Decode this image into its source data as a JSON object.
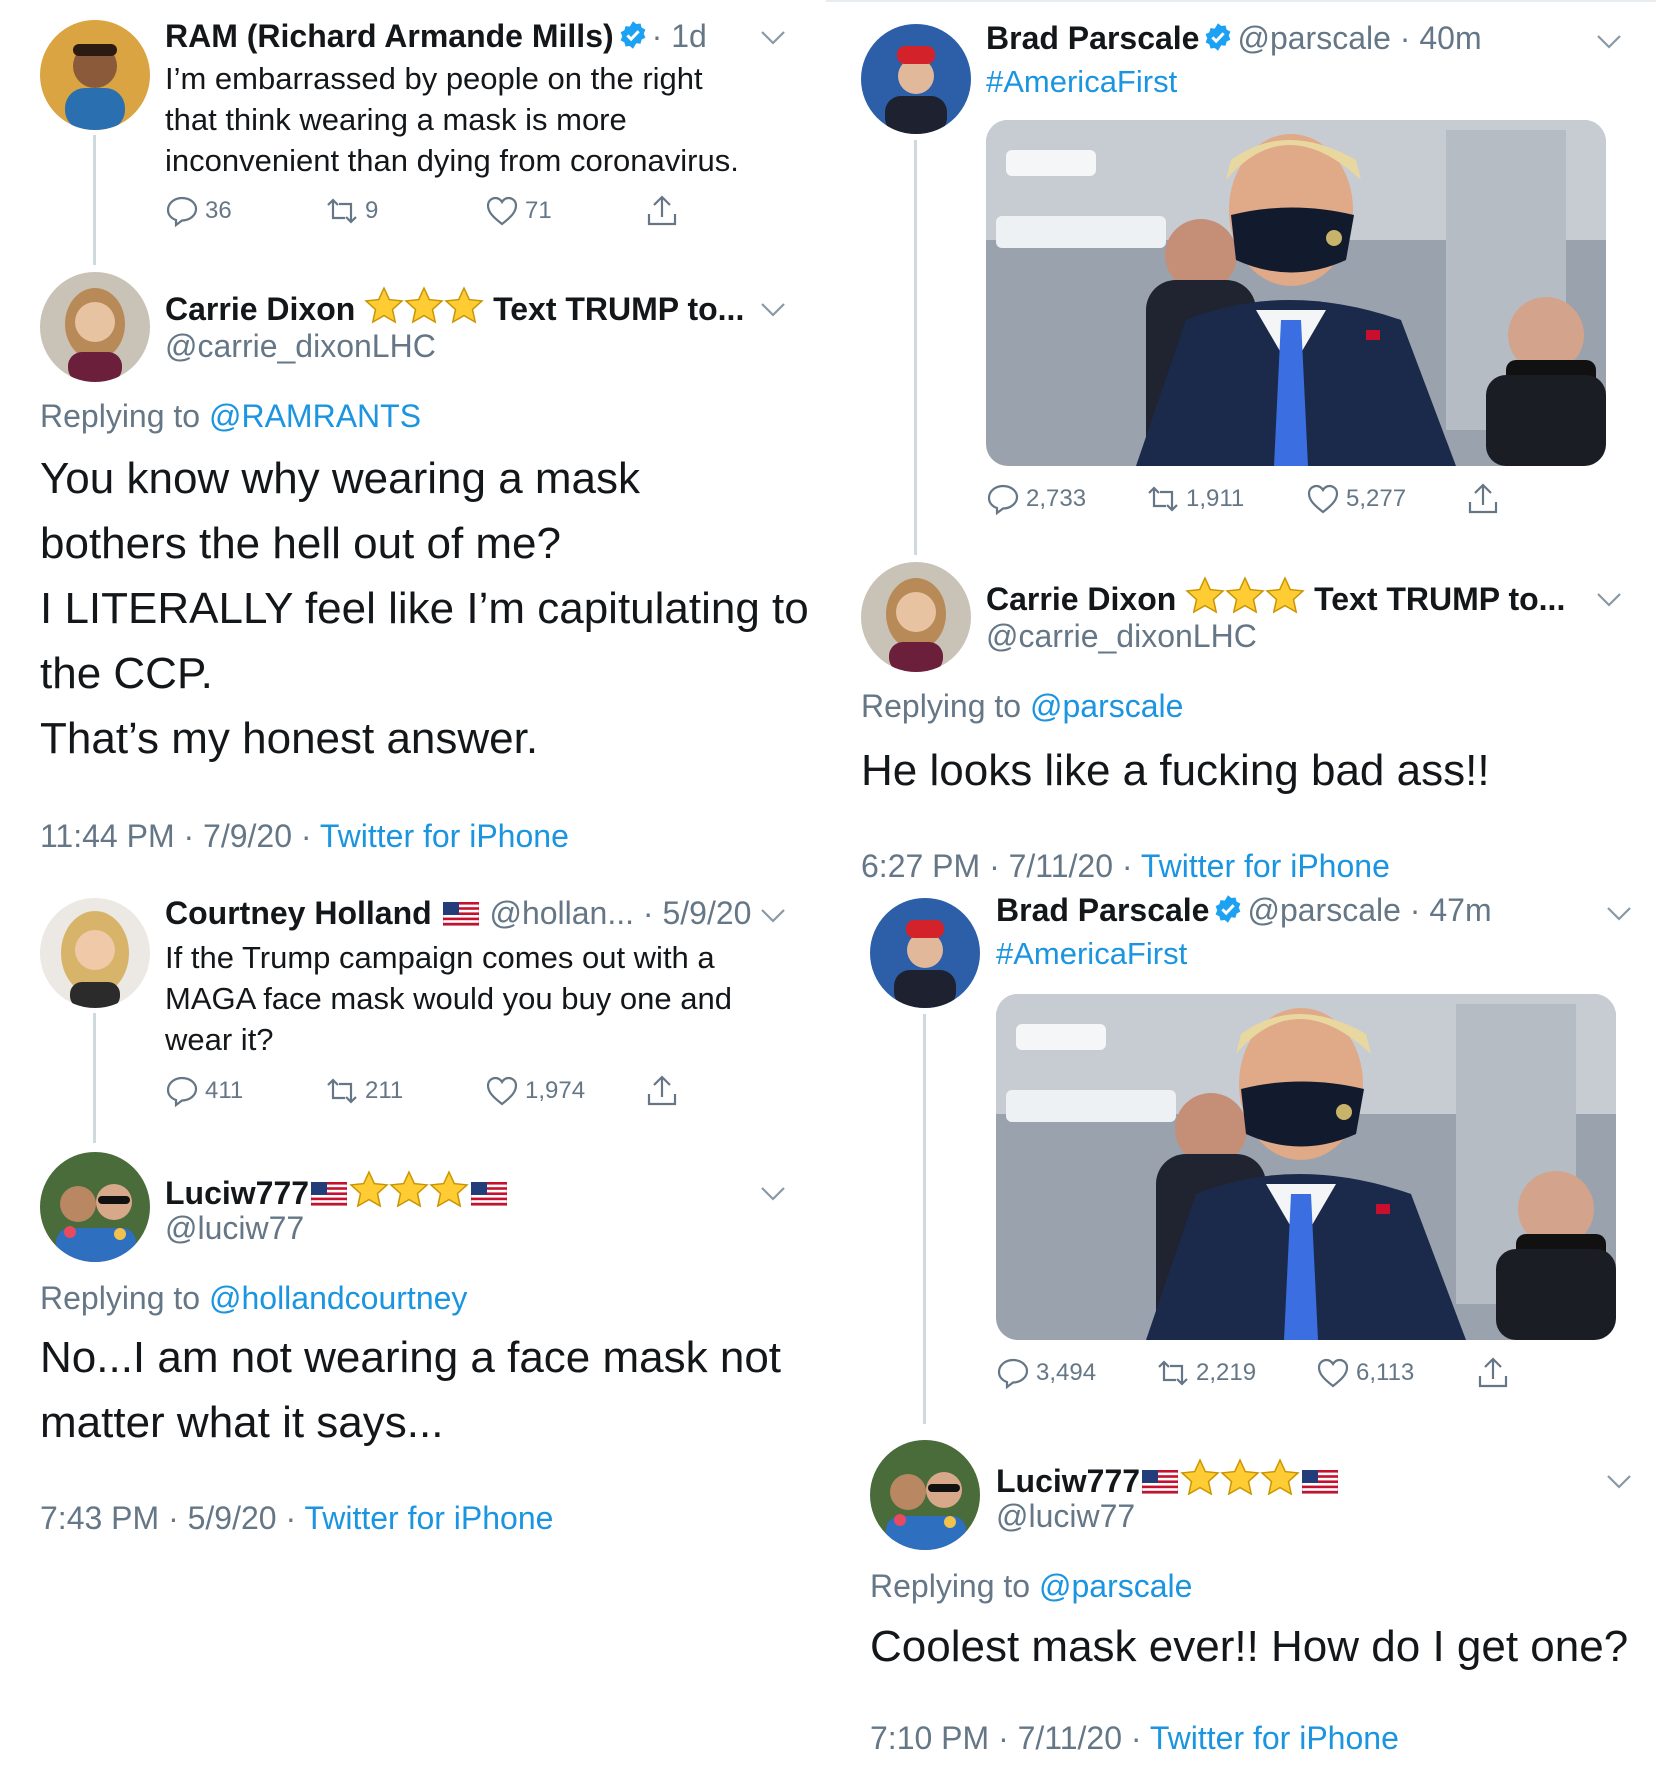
{
  "left": {
    "ram": {
      "name": "RAM (Richard Armande Mills)",
      "age": "· 1d",
      "text_lines": [
        "I’m embarrassed by people on the right",
        "that think wearing a mask is more",
        "inconvenient than dying from coronavirus."
      ],
      "replies": "36",
      "retweets": "9",
      "likes": "71"
    },
    "carrie1": {
      "name": "Carrie Dixon",
      "name_suffix": "Text TRUMP to...",
      "handle": "@carrie_dixonLHC",
      "replying_prefix": "Replying to",
      "replying_to": "@RAMRANTS",
      "body_lines": [
        "You know why wearing a mask",
        "bothers the hell out of me?",
        "I LITERALLY feel like I’m capitulating to",
        "the CCP.",
        "That’s my honest answer."
      ],
      "time": "11:44 PM · 7/9/20 ·",
      "source": "Twitter for iPhone"
    },
    "courtney": {
      "name": "Courtney Holland",
      "handle_age": "@hollan... · 5/9/20",
      "text_lines": [
        "If the Trump campaign comes out with a",
        "MAGA face mask would you buy one and",
        "wear it?"
      ],
      "replies": "411",
      "retweets": "211",
      "likes": "1,974"
    },
    "luciw1": {
      "name": "Luciw777",
      "handle": "@luciw77",
      "replying_prefix": "Replying to",
      "replying_to": "@hollandcourtney",
      "body_lines": [
        "No...I am not wearing a face mask not",
        "matter what it says..."
      ],
      "time": "7:43 PM · 5/9/20 ·",
      "source": "Twitter for iPhone"
    }
  },
  "right": {
    "brad1": {
      "name": "Brad Parscale",
      "handle_age": "@parscale · 40m",
      "hashtag": "#AmericaFirst",
      "replies": "2,733",
      "retweets": "1,911",
      "likes": "5,277"
    },
    "carrie2": {
      "name": "Carrie Dixon",
      "name_suffix": "Text TRUMP to...",
      "handle": "@carrie_dixonLHC",
      "replying_prefix": "Replying to",
      "replying_to": "@parscale",
      "body_lines": [
        "He looks like a fucking bad ass!!"
      ],
      "time": "6:27 PM · 7/11/20 ·",
      "source": "Twitter for iPhone"
    },
    "brad2": {
      "name": "Brad Parscale",
      "handle_age": "@parscale · 47m",
      "hashtag": "#AmericaFirst",
      "replies": "3,494",
      "retweets": "2,219",
      "likes": "6,113"
    },
    "luciw2": {
      "name": "Luciw777",
      "handle": "@luciw77",
      "replying_prefix": "Replying to",
      "replying_to": "@parscale",
      "body_lines": [
        "Coolest mask ever!! How do I get one?"
      ],
      "time": "7:10 PM · 7/11/20 ·",
      "source": "Twitter for iPhone"
    }
  },
  "colors": {
    "link": "#1b95e0",
    "muted": "#657786",
    "verified": "#1da1f2",
    "star": "#ffcc33"
  },
  "icons": [
    "verified-badge-icon",
    "chevron-down-icon",
    "reply-icon",
    "retweet-icon",
    "like-icon",
    "share-icon",
    "star-icon",
    "us-flag-icon"
  ]
}
